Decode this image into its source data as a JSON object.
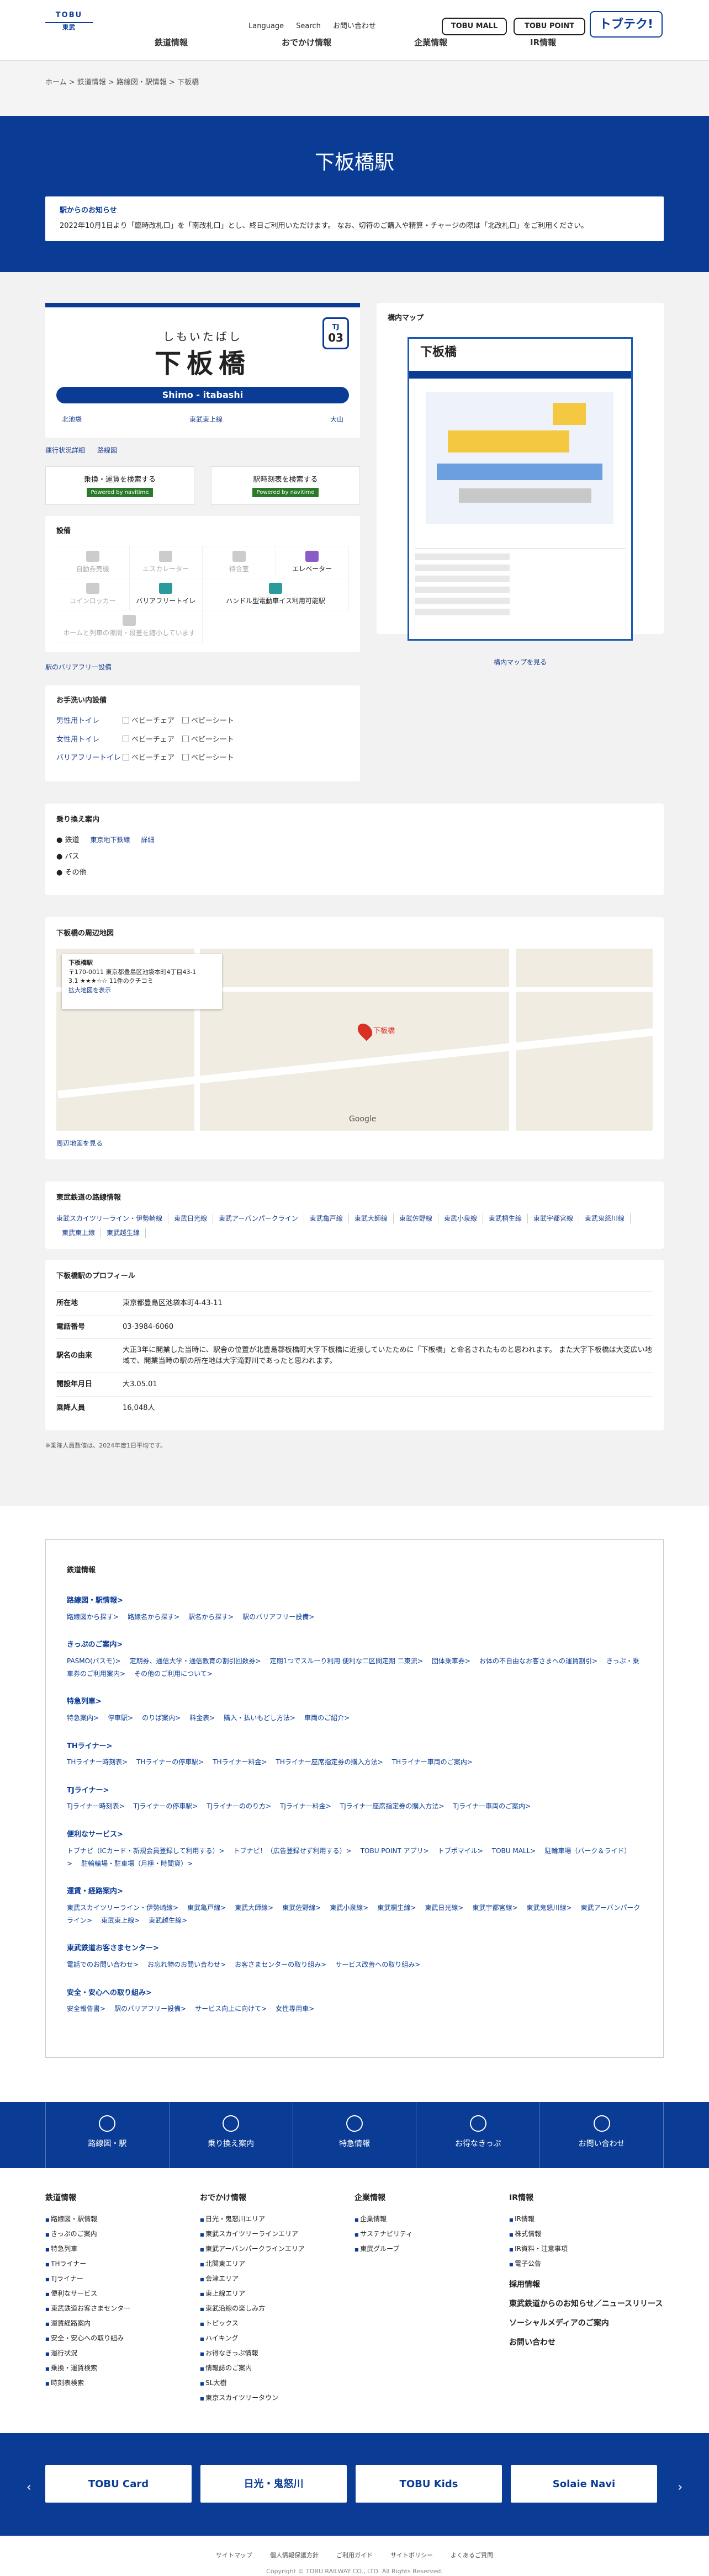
{
  "header": {
    "logo_mark": "TOBU",
    "logo_word": "東武",
    "nav": [
      "鉄道情報",
      "おでかけ情報",
      "企業情報",
      "IR情報"
    ],
    "util": [
      "Language",
      "Search",
      "お問い合わせ"
    ],
    "pills": [
      "TOBU MALL",
      "TOBU POINT",
      "トブテク!"
    ]
  },
  "breadcrumb": "ホーム > 鉄道情報 > 路線図・駅情報 > 下板橋",
  "station": {
    "title": "下板橋駅",
    "notice_title": "駅からのお知らせ",
    "notice_body": "2022年10月1日より「臨時改札口」を「南改札口」とし、終日ご利用いただけます。 なお、切符のご購入や精算・チャージの際は「北改札口」をご利用ください。",
    "kana": "しもいたばし",
    "kanji": "下板橋",
    "code_line": "TJ",
    "code_num": "03",
    "romaji": "Shimo - itabashi",
    "prev": "北池袋",
    "line": "東武東上線",
    "next": "大山",
    "sublinks": [
      "運行状況詳細",
      "路線図"
    ],
    "search": [
      {
        "label": "乗換・運賃を検索する",
        "badge": "Powered by navitime"
      },
      {
        "label": "駅時刻表を検索する",
        "badge": "Powered by navitime"
      }
    ]
  },
  "facilities": {
    "title": "設備",
    "items": [
      {
        "label": "自動券売機",
        "on": false
      },
      {
        "label": "エスカレーター",
        "on": false
      },
      {
        "label": "待合室",
        "on": false
      },
      {
        "label": "エレベーター",
        "on": true,
        "color": "purple"
      },
      {
        "label": "コインロッカー",
        "on": false
      },
      {
        "label": "バリアフリートイレ",
        "on": true
      },
      {
        "label": "ハンドル型電動車イス利用可能駅",
        "on": true,
        "wide": true
      }
    ],
    "note": "ホームと列車の隙間・段差を縮小しています",
    "barrier_link": "駅のバリアフリー設備"
  },
  "toilet": {
    "title": "お手洗い内設備",
    "rows": [
      {
        "label": "男性用トイレ",
        "opts": [
          "ベビーチェア",
          "ベビーシート"
        ]
      },
      {
        "label": "女性用トイレ",
        "opts": [
          "ベビーチェア",
          "ベビーシート"
        ]
      },
      {
        "label": "バリアフリートイレ",
        "opts": [
          "ベビーチェア",
          "ベビーシート"
        ]
      }
    ]
  },
  "yard_map": {
    "title": "構内マップ",
    "map_title": "下板橋",
    "link": "構内マップを見る"
  },
  "transfer": {
    "title": "乗り換え案内",
    "items": [
      {
        "label": "鉄道",
        "links": [
          "東京地下鉄線",
          "詳細"
        ]
      },
      {
        "label": "バス",
        "links": []
      },
      {
        "label": "その他",
        "links": []
      }
    ]
  },
  "surround": {
    "title": "下板橋の周辺地図",
    "info_name": "下板橋駅",
    "info_addr": "〒170-0011 東京都豊島区池袋本町4丁目43-1",
    "info_rating": "3.1 ★★★☆☆  11件のクチコミ",
    "info_link": "拡大地図を表示",
    "pin_label": "下板橋",
    "google": "Google",
    "link": "周辺地図を見る"
  },
  "lines": {
    "title": "東武鉄道の路線情報",
    "items": [
      "東武スカイツリーライン・伊勢崎線",
      "東武日光線",
      "東武アーバンパークライン",
      "東武亀戸線",
      "東武大師線",
      "東武佐野線",
      "東武小泉線",
      "東武桐生線",
      "東武宇都宮線",
      "東武鬼怒川線",
      "東武東上線",
      "東武越生線"
    ]
  },
  "profile": {
    "title": "下板橋駅のプロフィール",
    "rows": [
      {
        "k": "所在地",
        "v": "東京都豊島区池袋本町4-43-11"
      },
      {
        "k": "電話番号",
        "v": "03-3984-6060"
      },
      {
        "k": "駅名の由来",
        "v": "大正3年に開業した当時に、駅舎の位置が北豊島郡板橋町大字下板橋に近接していたために「下板橋」と命名されたものと思われます。 また大字下板橋は大変広い地域で、開業当時の駅の所在地は大字滝野川であったと思われます。"
      },
      {
        "k": "開設年月日",
        "v": "大3.05.01"
      },
      {
        "k": "乗降人員",
        "v": "16,048人"
      }
    ],
    "footnote": "※乗降人員数値は、2024年度1日平均です。"
  },
  "sitemap": {
    "title": "鉄道情報",
    "groups": [
      {
        "t": "路線図・駅情報>",
        "l": [
          "路線図から探す>",
          "路線名から探す>",
          "駅名から探す>",
          "駅のバリアフリー設備>"
        ]
      },
      {
        "t": "きっぷのご案内>",
        "l": [
          "PASMO(パスモ)>",
          "定期券、通信大学・通信教育の割引回数券>",
          "定期1つでスルーり利用 便利な二区間定期 二東流>",
          "団体乗車券>",
          "お体の不自由なお客さまへの運賃割引>",
          "きっぷ・乗車券のご利用案内>",
          "その他のご利用について>"
        ]
      },
      {
        "t": "特急列車>",
        "l": [
          "特急案内>",
          "停車駅>",
          "のりば案内>",
          "料金表>",
          "購入・払いもどし方法>",
          "車両のご紹介>"
        ]
      },
      {
        "t": "THライナー>",
        "l": [
          "THライナー時刻表>",
          "THライナーの停車駅>",
          "THライナー料金>",
          "THライナー座席指定券の購入方法>",
          "THライナー車両のご案内>"
        ]
      },
      {
        "t": "TJライナー>",
        "l": [
          "TJライナー時刻表>",
          "TJライナーの停車駅>",
          "TJライナーののり方>",
          "TJライナー料金>",
          "TJライナー座席指定券の購入方法>",
          "TJライナー車両のご案内>"
        ]
      },
      {
        "t": "便利なサービス>",
        "l": [
          "トブナビ（ICカード・新規会員登録して利用する）>",
          "トブナビ！（広告登録せず利用する）>",
          "TOBU POINT アプリ>",
          "トブポマイル>",
          "TOBU MALL>",
          "駐輪車場（パーク＆ライド）>",
          "駐輪輪場・駐車場（月極・時間貸）>"
        ]
      },
      {
        "t": "運賃・経路案内>",
        "l": [
          "東武スカイツリーライン・伊勢崎線>",
          "東武亀戸線>",
          "東武大師線>",
          "東武佐野線>",
          "東武小泉線>",
          "東武桐生線>",
          "東武日光線>",
          "東武宇都宮線>",
          "東武鬼怒川線>",
          "東武アーバンパークライン>",
          "東武東上線>",
          "東武越生線>"
        ]
      },
      {
        "t": "東武鉄道お客さまセンター>",
        "l": [
          "電話でのお問い合わせ>",
          "お忘れ物のお問い合わせ>",
          "お客さまセンターの取り組み>",
          "サービス改善への取り組み>"
        ]
      },
      {
        "t": "安全・安心への取り組み>",
        "l": [
          "安全報告書>",
          "駅のバリアフリー設備>",
          "サービス向上に向けて>",
          "女性専用車>"
        ]
      }
    ]
  },
  "footer_nav": [
    "路線図・駅",
    "乗り換え案内",
    "特急情報",
    "お得なきっぷ",
    "お問い合わせ"
  ],
  "footer_cols": [
    {
      "t": "鉄道情報",
      "l": [
        "路線図・駅情報",
        "きっぷのご案内",
        "特急列車",
        "THライナー",
        "TJライナー",
        "便利なサービス",
        "東武鉄道お客さまセンター",
        "運賃経路案内",
        "安全・安心への取り組み",
        "運行状況",
        "乗換・運賃検索",
        "時刻表検索"
      ]
    },
    {
      "t": "おでかけ情報",
      "l": [
        "日光・鬼怒川エリア",
        "東武スカイツリーラインエリア",
        "東武アーバンパークラインエリア",
        "北関東エリア",
        "会津エリア",
        "東上線エリア",
        "東武沿線の楽しみ方",
        "トピックス",
        "ハイキング",
        "お得なきっぷ情報",
        "情報誌のご案内",
        "SL大樹",
        "東京スカイツリータウン"
      ]
    },
    {
      "t": "企業情報",
      "l": [
        "企業情報",
        "サステナビリティ",
        "東武グループ"
      ]
    },
    {
      "t": "IR情報",
      "l": [
        "IR情報",
        "株式情報",
        "IR資料・注意事項",
        "電子公告"
      ],
      "extra": [
        "採用情報",
        "東武鉄道からのお知らせ／ニュースリリース",
        "ソーシャルメディアのご案内",
        "お問い合わせ"
      ]
    }
  ],
  "banners": [
    "TOBU Card",
    "日光・鬼怒川",
    "TOBU Kids",
    "Solaie Navi"
  ],
  "foot": {
    "links": [
      "サイトマップ",
      "個人情報保護方針",
      "ご利用ガイド",
      "サイトポリシー",
      "よくあるご質問"
    ],
    "copyright": "Copyright © TOBU RAILWAY CO., LTD. All Rights Reserved."
  }
}
